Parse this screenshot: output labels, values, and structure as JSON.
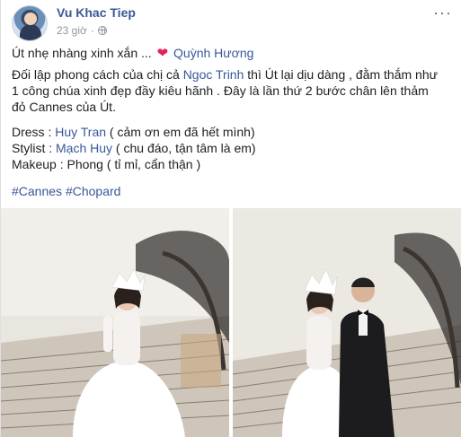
{
  "post": {
    "author": "Vu Khac Tiep",
    "time": "23 giờ",
    "more_label": "···",
    "line1_prefix": "Út nhẹ nhàng xinh xắn ... ",
    "line1_mention": "Quỳnh Hương",
    "p2_part1": "Đối lập phong cách của chị cả ",
    "p2_mention": "Ngoc Trinh",
    "p2_part2": " thì Út lại dịu dàng , đằm thắm như 1 công chúa xinh đẹp đầy kiêu hãnh . Đây là lần thứ 2 bước chân lên thảm đỏ Cannes của Út.",
    "dress_prefix": "Dress : ",
    "dress_link": "Huy Tran",
    "dress_suffix": " ( cảm ơn em đã hết mình)",
    "stylist_prefix": "Stylist : ",
    "stylist_link": "Mạch Huy",
    "stylist_suffix": " ( chu đáo, tận tâm là em)",
    "makeup_line": "Makeup : Phong ( tỉ mỉ, cẩn thận )",
    "hashtag1": "#Cannes",
    "hashtag2": "#Chopard"
  },
  "colors": {
    "link": "#385898",
    "meta": "#90949c",
    "heart": "#e0245e"
  },
  "icons": [
    "globe-icon",
    "more-icon",
    "heart-icon"
  ]
}
